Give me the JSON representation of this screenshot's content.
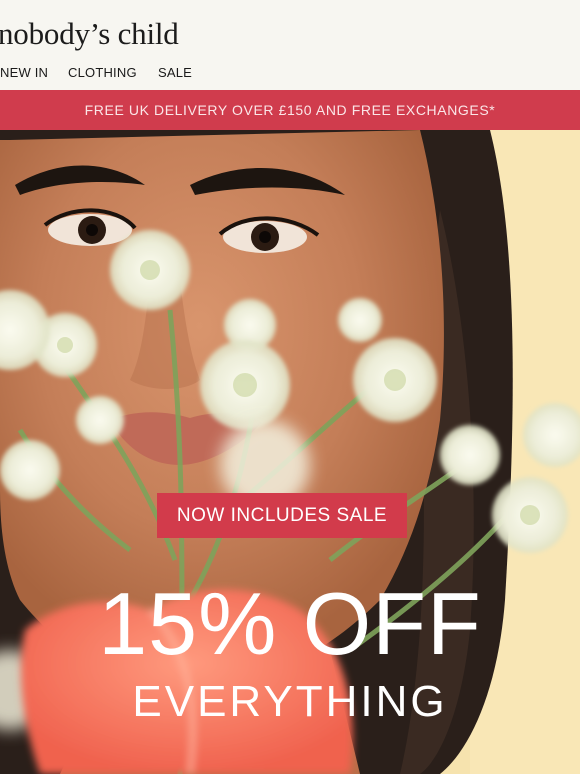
{
  "brand": {
    "logo_text": "nobody’s child"
  },
  "nav": {
    "items": [
      "NEW IN",
      "CLOTHING",
      "SALE"
    ]
  },
  "promo_banner": {
    "text": "FREE UK DELIVERY OVER £150 AND FREE EXCHANGES*"
  },
  "hero": {
    "badge": "NOW INCLUDES SALE",
    "headline": "15% OFF",
    "subline": "EVERYTHING",
    "image": "woman-with-white-flowers"
  },
  "colors": {
    "banner": "#d03c4d",
    "badge": "#d23b4b",
    "hero_background": "#f6e3ae",
    "header_background": "#f7f6f1"
  }
}
